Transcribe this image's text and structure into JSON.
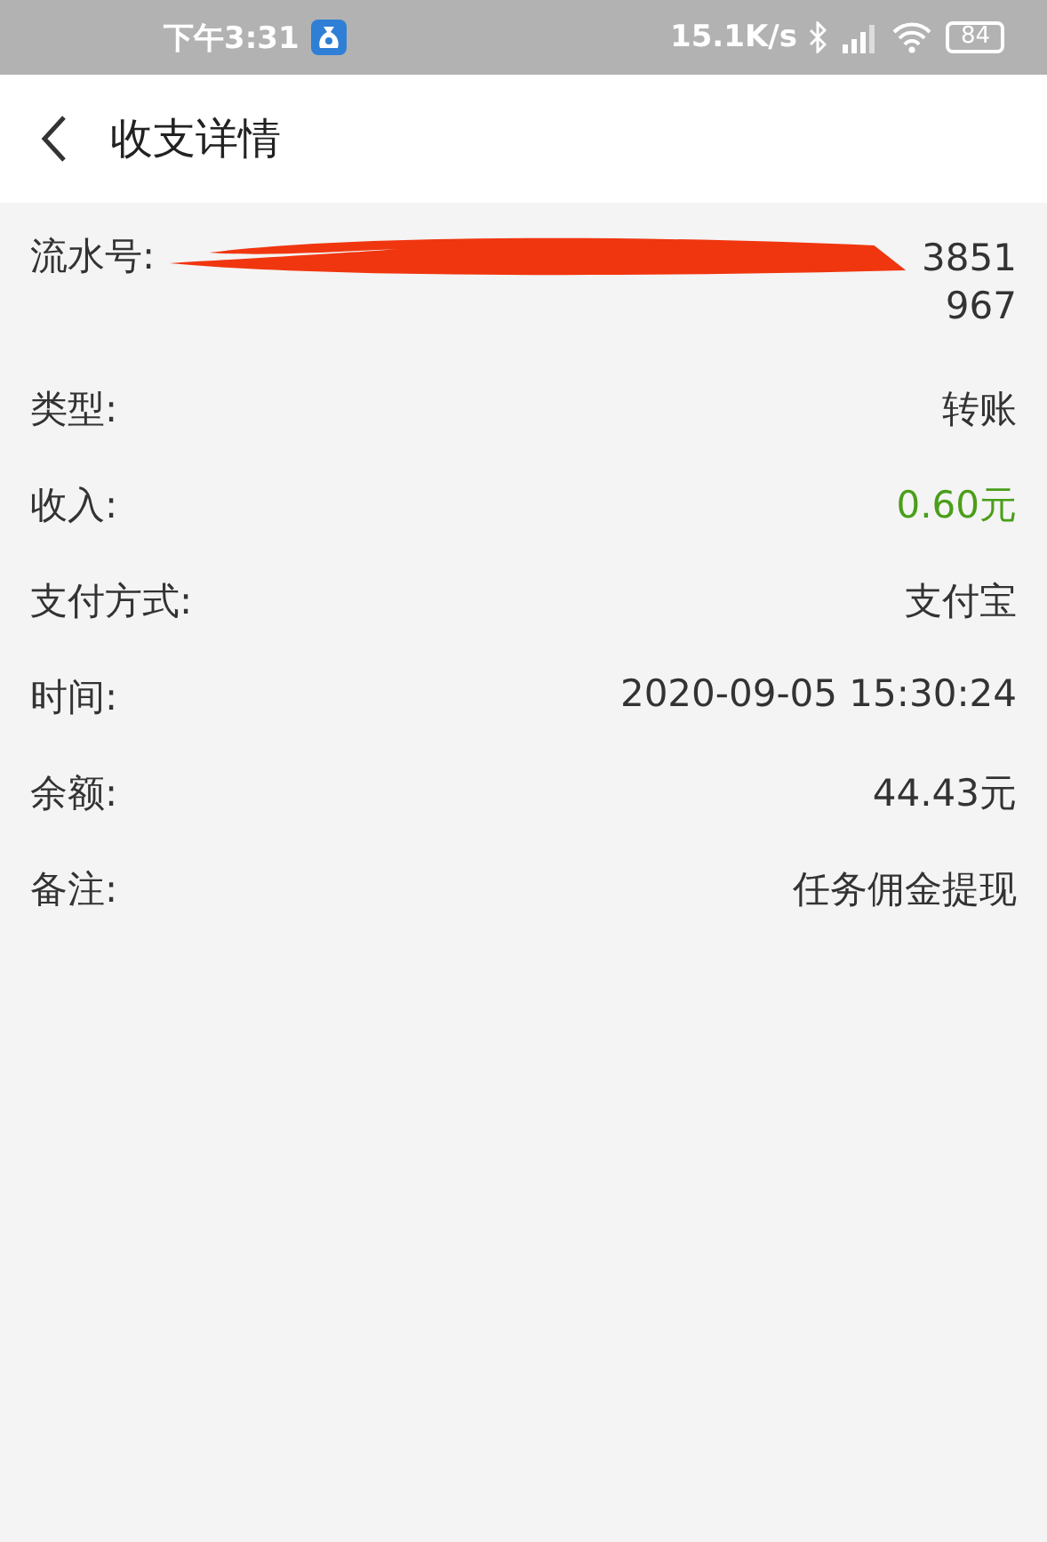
{
  "status_bar": {
    "time": "下午3:31",
    "net_speed": "15.1K/s",
    "battery": "84"
  },
  "header": {
    "title": "收支详情"
  },
  "serial": {
    "label": "流水号:",
    "value_tail": "3851",
    "value_line_2": "967"
  },
  "rows": [
    {
      "label": "类型:",
      "value": "转账",
      "kind": "text"
    },
    {
      "label": "收入:",
      "value": "0.60元",
      "kind": "income"
    },
    {
      "label": "支付方式:",
      "value": "支付宝",
      "kind": "text"
    },
    {
      "label": "时间:",
      "value": "2020-09-05 15:30:24",
      "kind": "text"
    },
    {
      "label": "余额:",
      "value": "44.43元",
      "kind": "text"
    },
    {
      "label": "备注:",
      "value": "任务佣金提现",
      "kind": "text"
    }
  ]
}
